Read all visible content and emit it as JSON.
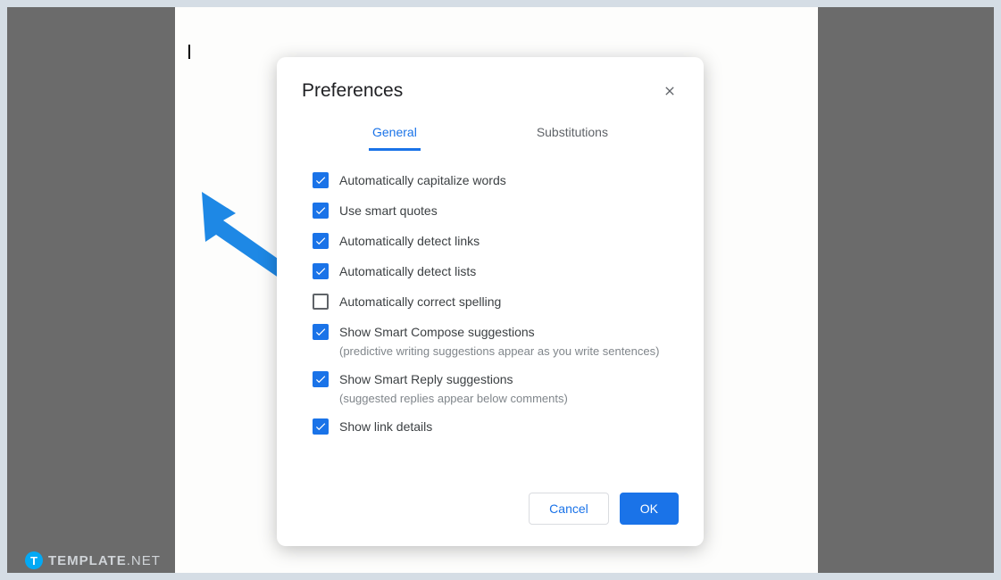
{
  "dialog": {
    "title": "Preferences",
    "tabs": {
      "general": "General",
      "substitutions": "Substitutions"
    },
    "options": [
      {
        "label": "Automatically capitalize words",
        "checked": true
      },
      {
        "label": "Use smart quotes",
        "checked": true
      },
      {
        "label": "Automatically detect links",
        "checked": true
      },
      {
        "label": "Automatically detect lists",
        "checked": true
      },
      {
        "label": "Automatically correct spelling",
        "checked": false
      },
      {
        "label": "Show Smart Compose suggestions",
        "sub": "(predictive writing suggestions appear as you write sentences)",
        "checked": true
      },
      {
        "label": "Show Smart Reply suggestions",
        "sub": "(suggested replies appear below comments)",
        "checked": true
      },
      {
        "label": "Show link details",
        "checked": true
      }
    ],
    "buttons": {
      "cancel": "Cancel",
      "ok": "OK"
    }
  },
  "watermark": {
    "icon_letter": "T",
    "brand": "TEMPLATE",
    "suffix": ".NET"
  }
}
